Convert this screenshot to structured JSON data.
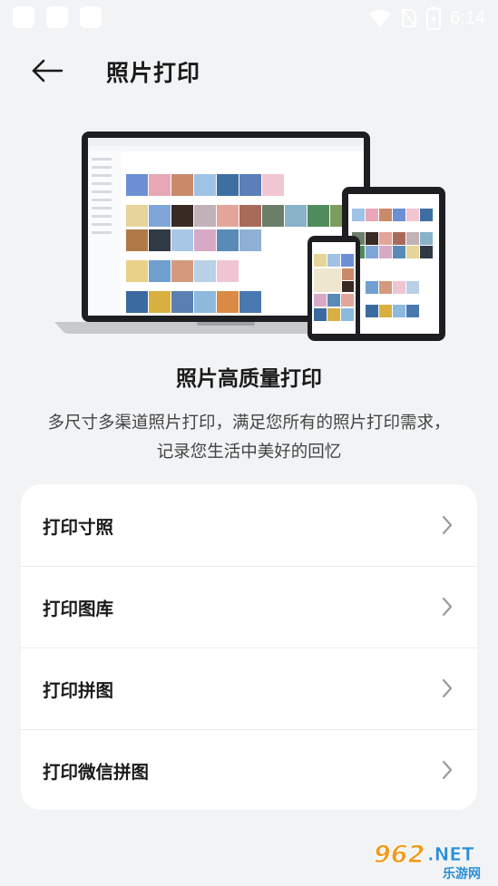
{
  "status_bar": {
    "time": "6:14"
  },
  "header": {
    "title": "照片打印"
  },
  "promo": {
    "title": "照片高质量打印",
    "desc_line1": "多尺寸多渠道照片打印，满足您所有的照片打印需求，",
    "desc_line2": "记录您生活中美好的回忆"
  },
  "menu": {
    "items": [
      {
        "label": "打印寸照"
      },
      {
        "label": "打印图库"
      },
      {
        "label": "打印拼图"
      },
      {
        "label": "打印微信拼图"
      }
    ]
  },
  "watermark": {
    "brand": "962.NET",
    "sub": "乐游网"
  },
  "colors": {
    "background": "#f1f3f5",
    "card": "#ffffff",
    "text": "#1a1a1a",
    "chevron": "#9a9a9a"
  }
}
